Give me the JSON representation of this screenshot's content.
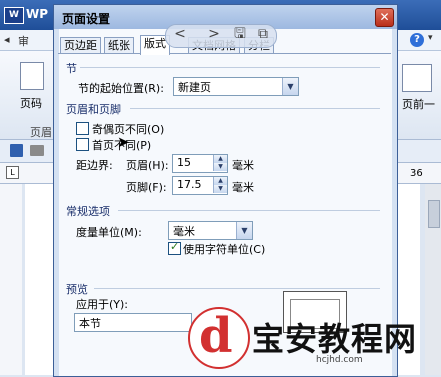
{
  "app": {
    "name": "WP",
    "logo": "W",
    "left_arrow": "◂",
    "left_menu": "审",
    "help_icon": "?",
    "help_arrow": "▾",
    "ribbon": {
      "page_code": "页码",
      "header_footer": "页眉",
      "prev": "页前一"
    },
    "ruler": {
      "corner": "L",
      "number": "36"
    }
  },
  "dialog": {
    "title": "页面设置",
    "logo": "W",
    "close": "✕",
    "tabs": [
      {
        "label": "页边距",
        "active": false
      },
      {
        "label": "纸张",
        "active": false
      },
      {
        "label": "版式",
        "active": true
      },
      {
        "label": "文档网格",
        "active": false
      },
      {
        "label": "分栏",
        "active": false
      }
    ],
    "nav": {
      "back": "<",
      "forward": ">",
      "save": "🖫",
      "copy": "⧉"
    },
    "section": {
      "title": "节",
      "start_label": "节的起始位置(R):",
      "start_value": "新建页"
    },
    "header_footer": {
      "title": "页眉和页脚",
      "odd_even_label": "奇偶页不同(O)",
      "odd_even_checked": false,
      "first_page_label": "首页不同(P)",
      "first_page_checked": false,
      "margin_label": "距边界:",
      "header_label": "页眉(H):",
      "header_value": "15",
      "header_unit": "毫米",
      "footer_label": "页脚(F):",
      "footer_value": "17.5",
      "footer_unit": "毫米"
    },
    "general": {
      "title": "常规选项",
      "unit_label": "度量单位(M):",
      "unit_value": "毫米",
      "char_unit_label": "使用字符单位(C)",
      "char_unit_checked": true
    },
    "preview": {
      "title": "预览",
      "apply_label": "应用于(Y):",
      "apply_value": "本节"
    }
  },
  "watermark": {
    "brand": "宝安教程网",
    "domain": "hcjhd.com",
    "logo_letter": "d"
  }
}
